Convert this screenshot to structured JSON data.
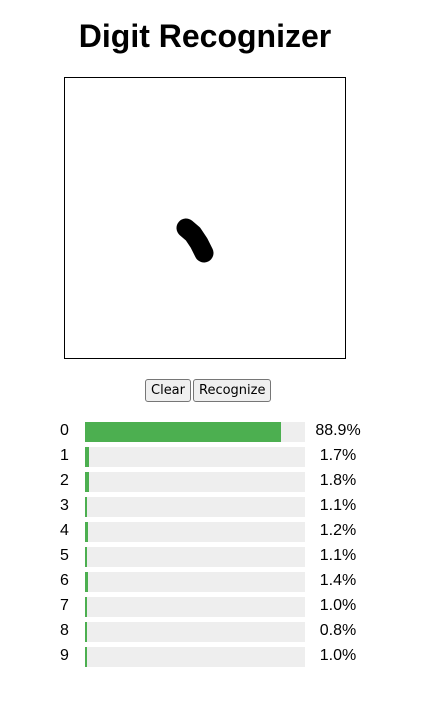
{
  "app": {
    "title": "Digit Recognizer"
  },
  "controls": {
    "clear_label": "Clear",
    "recognize_label": "Recognize"
  },
  "accent_color": "#4caf50",
  "predictions": [
    {
      "digit": "0",
      "percent_text": "88.9%",
      "value": 88.9
    },
    {
      "digit": "1",
      "percent_text": "1.7%",
      "value": 1.7
    },
    {
      "digit": "2",
      "percent_text": "1.8%",
      "value": 1.8
    },
    {
      "digit": "3",
      "percent_text": "1.1%",
      "value": 1.1
    },
    {
      "digit": "4",
      "percent_text": "1.2%",
      "value": 1.2
    },
    {
      "digit": "5",
      "percent_text": "1.1%",
      "value": 1.1
    },
    {
      "digit": "6",
      "percent_text": "1.4%",
      "value": 1.4
    },
    {
      "digit": "7",
      "percent_text": "1.0%",
      "value": 1.0
    },
    {
      "digit": "8",
      "percent_text": "0.8%",
      "value": 0.8
    },
    {
      "digit": "9",
      "percent_text": "1.0%",
      "value": 1.0
    }
  ]
}
